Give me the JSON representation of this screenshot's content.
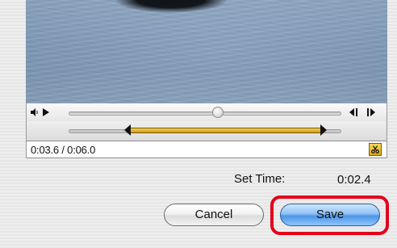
{
  "controller": {
    "time_readout": "0:03.6 / 0:06.0",
    "playhead_fraction": 0.55,
    "trim_start_fraction": 0.23,
    "trim_end_fraction": 0.93
  },
  "set_time": {
    "label": "Set Time:",
    "value": "0:02.4"
  },
  "buttons": {
    "cancel_label": "Cancel",
    "save_label": "Save"
  },
  "colors": {
    "trim_selection": "#d9a81a",
    "save_highlight": "#e4001b",
    "save_button": "#4e95e5"
  },
  "icons": {
    "volume": "speaker-icon",
    "play": "play-icon",
    "step_back": "step-back-icon",
    "step_forward": "step-forward-icon",
    "trim": "scissors-icon"
  }
}
